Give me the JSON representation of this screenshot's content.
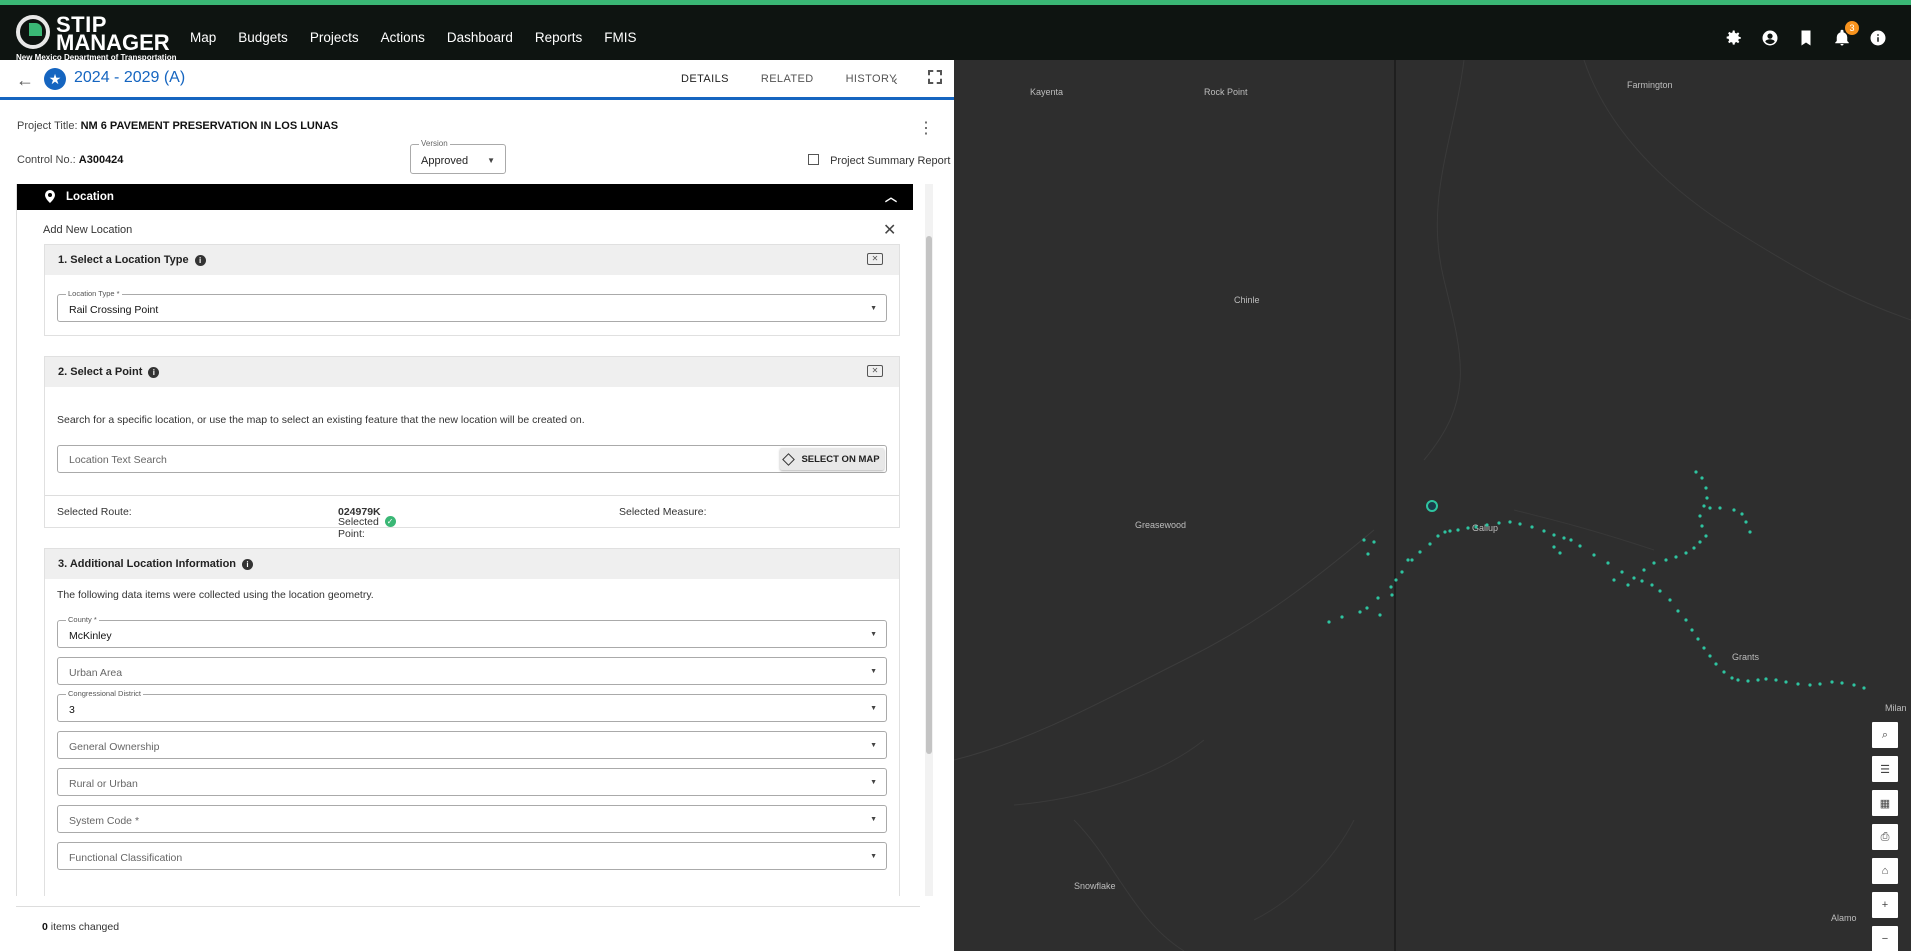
{
  "app": {
    "brand_line1": "STIP",
    "brand_line2": "MANAGER",
    "brand_sub": "New Mexico Department of Transportation",
    "accent": "#3ab775",
    "primary": "#1565c0"
  },
  "nav": [
    "Map",
    "Budgets",
    "Projects",
    "Actions",
    "Dashboard",
    "Reports",
    "FMIS"
  ],
  "top_icons": [
    "gear-icon",
    "account-icon",
    "bookmark-icon",
    "bell-icon",
    "info-icon"
  ],
  "notifications_count": "3",
  "subheader": {
    "title": "2024 - 2029 (A)",
    "tabs": [
      "DETAILS",
      "RELATED",
      "HISTORY"
    ],
    "active_tab": "DETAILS"
  },
  "project": {
    "title_label": "Project Title:",
    "title_value": "NM 6 PAVEMENT PRESERVATION IN LOS LUNAS",
    "control_label": "Control No.:",
    "control_value": "A300424",
    "version_label": "Version",
    "version_value": "Approved",
    "summary_link": "Project Summary Report"
  },
  "location": {
    "header": "Location",
    "add_new": "Add New Location",
    "step1": {
      "title": "1. Select a Location Type",
      "field_label": "Location Type *",
      "field_value": "Rail Crossing Point"
    },
    "step2": {
      "title": "2. Select a Point",
      "instructions": "Search for a specific location, or use the map to select an existing feature that the new location will be created on.",
      "search_placeholder": "Location Text Search",
      "select_button": "SELECT ON MAP",
      "selected_route_label": "Selected Route:",
      "selected_point_label": "Selected Point:",
      "selected_point_value": "024979K",
      "selected_measure_label": "Selected Measure:"
    },
    "step3": {
      "title": "3. Additional Location Information",
      "instructions": "The following data items were collected using the location geometry.",
      "fields": [
        {
          "label": "County *",
          "value": "McKinley",
          "placeholder": ""
        },
        {
          "label": "",
          "value": "",
          "placeholder": "Urban Area"
        },
        {
          "label": "Congressional District",
          "value": "3",
          "placeholder": ""
        },
        {
          "label": "",
          "value": "",
          "placeholder": "General Ownership"
        },
        {
          "label": "",
          "value": "",
          "placeholder": "Rural or Urban"
        },
        {
          "label": "",
          "value": "",
          "placeholder": "System Code *"
        },
        {
          "label": "",
          "value": "",
          "placeholder": "Functional Classification"
        }
      ]
    }
  },
  "footer": {
    "count": "0",
    "text": "items changed"
  },
  "map": {
    "labels": [
      "Kayenta",
      "Rock Point",
      "Farmington",
      "Chinle",
      "Greasewood",
      "Gallup",
      "Grants",
      "Milan",
      "Snowflake",
      "Alamo"
    ],
    "point_color": "#2ec4a0",
    "tools": [
      "search-icon",
      "list-icon",
      "qr-icon",
      "print-icon",
      "home-icon",
      "zoom-in-icon",
      "zoom-out-icon"
    ]
  }
}
